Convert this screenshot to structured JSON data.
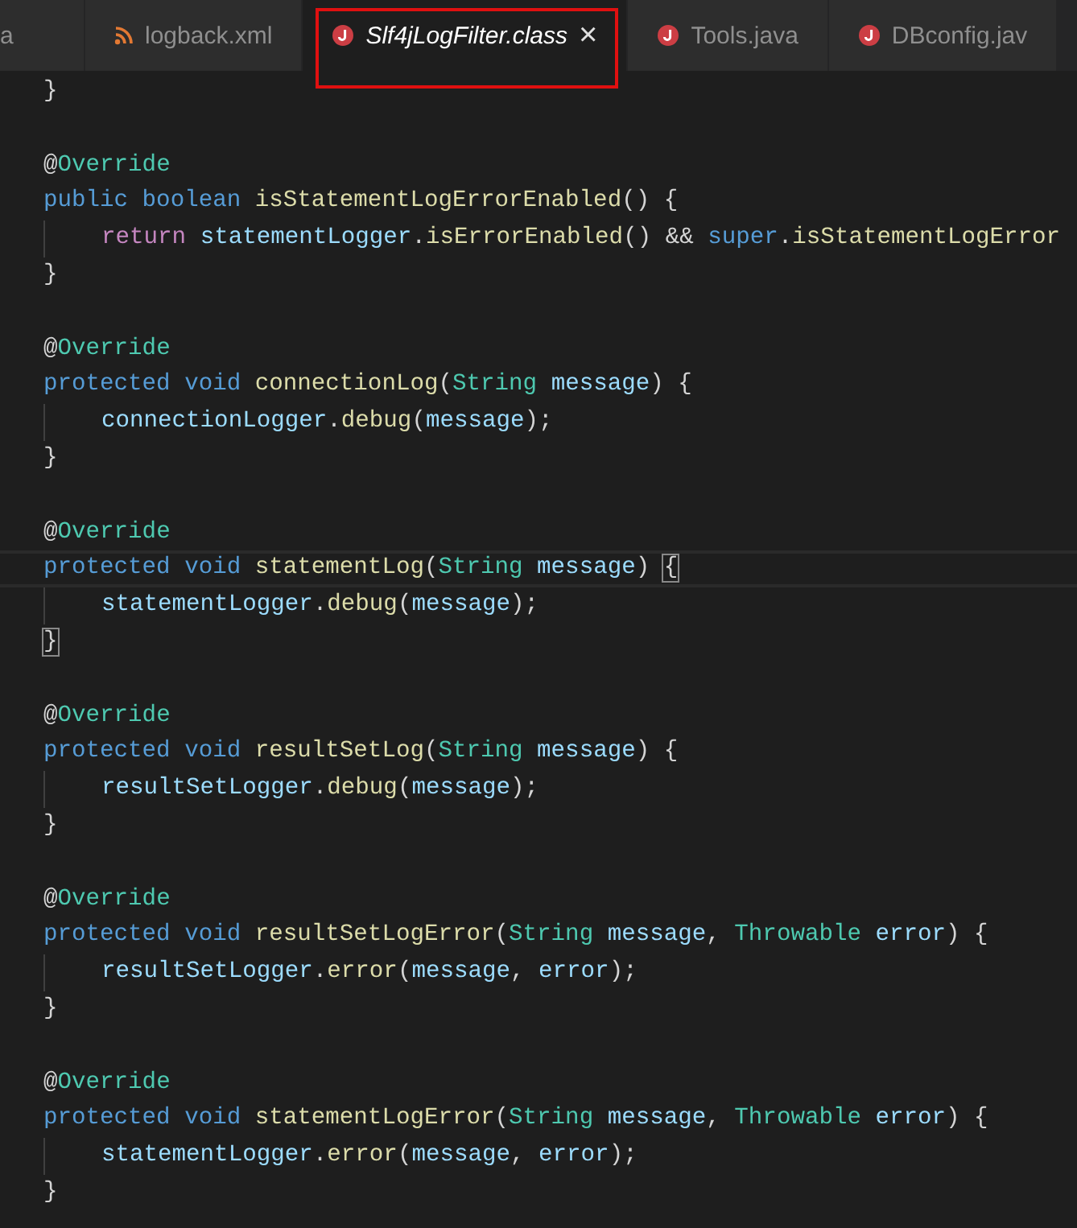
{
  "tabs": [
    {
      "label": "a",
      "kind": "plain",
      "selected": false,
      "preview": false,
      "closable": false,
      "highlighted": false
    },
    {
      "label": "logback.xml",
      "kind": "feed",
      "selected": false,
      "preview": false,
      "closable": false,
      "highlighted": false
    },
    {
      "label": "Slf4jLogFilter.class",
      "kind": "java",
      "selected": true,
      "preview": true,
      "closable": true,
      "highlighted": true
    },
    {
      "label": "Tools.java",
      "kind": "java",
      "selected": false,
      "preview": false,
      "closable": false,
      "highlighted": false
    },
    {
      "label": "DBconfig.jav",
      "kind": "java",
      "selected": false,
      "preview": false,
      "closable": false,
      "highlighted": false
    }
  ],
  "close_glyph": "×",
  "lines": [
    {
      "kind": "code",
      "indented": false,
      "current": false,
      "tokens": [
        {
          "kind": "plain",
          "text": "}"
        }
      ]
    },
    {
      "kind": "blank"
    },
    {
      "kind": "code",
      "indented": false,
      "current": false,
      "tokens": [
        {
          "kind": "plain",
          "text": "@"
        },
        {
          "kind": "type",
          "text": "Override"
        }
      ]
    },
    {
      "kind": "code",
      "indented": false,
      "current": false,
      "tokens": [
        {
          "kind": "keyword",
          "text": "public boolean "
        },
        {
          "kind": "method",
          "text": "isStatementLogErrorEnabled"
        },
        {
          "kind": "plain",
          "text": "() {"
        }
      ]
    },
    {
      "kind": "code",
      "indented": true,
      "current": false,
      "tokens": [
        {
          "kind": "control",
          "text": "return "
        },
        {
          "kind": "variable",
          "text": "statementLogger"
        },
        {
          "kind": "plain",
          "text": "."
        },
        {
          "kind": "method",
          "text": "isErrorEnabled"
        },
        {
          "kind": "plain",
          "text": "() && "
        },
        {
          "kind": "keyword",
          "text": "super"
        },
        {
          "kind": "plain",
          "text": "."
        },
        {
          "kind": "method",
          "text": "isStatementLogError"
        }
      ]
    },
    {
      "kind": "code",
      "indented": false,
      "current": false,
      "tokens": [
        {
          "kind": "plain",
          "text": "}"
        }
      ]
    },
    {
      "kind": "blank"
    },
    {
      "kind": "code",
      "indented": false,
      "current": false,
      "tokens": [
        {
          "kind": "plain",
          "text": "@"
        },
        {
          "kind": "type",
          "text": "Override"
        }
      ]
    },
    {
      "kind": "code",
      "indented": false,
      "current": false,
      "tokens": [
        {
          "kind": "keyword",
          "text": "protected void "
        },
        {
          "kind": "method",
          "text": "connectionLog"
        },
        {
          "kind": "plain",
          "text": "("
        },
        {
          "kind": "type",
          "text": "String "
        },
        {
          "kind": "variable",
          "text": "message"
        },
        {
          "kind": "plain",
          "text": ") {"
        }
      ]
    },
    {
      "kind": "code",
      "indented": true,
      "current": false,
      "tokens": [
        {
          "kind": "variable",
          "text": "connectionLogger"
        },
        {
          "kind": "plain",
          "text": "."
        },
        {
          "kind": "method",
          "text": "debug"
        },
        {
          "kind": "plain",
          "text": "("
        },
        {
          "kind": "variable",
          "text": "message"
        },
        {
          "kind": "plain",
          "text": ");"
        }
      ]
    },
    {
      "kind": "code",
      "indented": false,
      "current": false,
      "tokens": [
        {
          "kind": "plain",
          "text": "}"
        }
      ]
    },
    {
      "kind": "blank"
    },
    {
      "kind": "code",
      "indented": false,
      "current": false,
      "tokens": [
        {
          "kind": "plain",
          "text": "@"
        },
        {
          "kind": "type",
          "text": "Override"
        }
      ]
    },
    {
      "kind": "code",
      "indented": false,
      "current": true,
      "tokens": [
        {
          "kind": "keyword",
          "text": "protected void "
        },
        {
          "kind": "method",
          "text": "statementLog"
        },
        {
          "kind": "plain",
          "text": "("
        },
        {
          "kind": "type",
          "text": "String "
        },
        {
          "kind": "variable",
          "text": "message"
        },
        {
          "kind": "plain",
          "text": ") "
        },
        {
          "kind": "bracket",
          "text": "{",
          "matched": true
        }
      ]
    },
    {
      "kind": "code",
      "indented": true,
      "current": false,
      "tokens": [
        {
          "kind": "variable",
          "text": "statementLogger"
        },
        {
          "kind": "plain",
          "text": "."
        },
        {
          "kind": "method",
          "text": "debug"
        },
        {
          "kind": "plain",
          "text": "("
        },
        {
          "kind": "variable",
          "text": "message"
        },
        {
          "kind": "plain",
          "text": ");"
        }
      ]
    },
    {
      "kind": "code",
      "indented": false,
      "current": false,
      "tokens": [
        {
          "kind": "bracket",
          "text": "}",
          "matched": true
        }
      ]
    },
    {
      "kind": "blank"
    },
    {
      "kind": "code",
      "indented": false,
      "current": false,
      "tokens": [
        {
          "kind": "plain",
          "text": "@"
        },
        {
          "kind": "type",
          "text": "Override"
        }
      ]
    },
    {
      "kind": "code",
      "indented": false,
      "current": false,
      "tokens": [
        {
          "kind": "keyword",
          "text": "protected void "
        },
        {
          "kind": "method",
          "text": "resultSetLog"
        },
        {
          "kind": "plain",
          "text": "("
        },
        {
          "kind": "type",
          "text": "String "
        },
        {
          "kind": "variable",
          "text": "message"
        },
        {
          "kind": "plain",
          "text": ") {"
        }
      ]
    },
    {
      "kind": "code",
      "indented": true,
      "current": false,
      "tokens": [
        {
          "kind": "variable",
          "text": "resultSetLogger"
        },
        {
          "kind": "plain",
          "text": "."
        },
        {
          "kind": "method",
          "text": "debug"
        },
        {
          "kind": "plain",
          "text": "("
        },
        {
          "kind": "variable",
          "text": "message"
        },
        {
          "kind": "plain",
          "text": ");"
        }
      ]
    },
    {
      "kind": "code",
      "indented": false,
      "current": false,
      "tokens": [
        {
          "kind": "plain",
          "text": "}"
        }
      ]
    },
    {
      "kind": "blank"
    },
    {
      "kind": "code",
      "indented": false,
      "current": false,
      "tokens": [
        {
          "kind": "plain",
          "text": "@"
        },
        {
          "kind": "type",
          "text": "Override"
        }
      ]
    },
    {
      "kind": "code",
      "indented": false,
      "current": false,
      "tokens": [
        {
          "kind": "keyword",
          "text": "protected void "
        },
        {
          "kind": "method",
          "text": "resultSetLogError"
        },
        {
          "kind": "plain",
          "text": "("
        },
        {
          "kind": "type",
          "text": "String "
        },
        {
          "kind": "variable",
          "text": "message"
        },
        {
          "kind": "plain",
          "text": ", "
        },
        {
          "kind": "type",
          "text": "Throwable "
        },
        {
          "kind": "variable",
          "text": "error"
        },
        {
          "kind": "plain",
          "text": ") {"
        }
      ]
    },
    {
      "kind": "code",
      "indented": true,
      "current": false,
      "tokens": [
        {
          "kind": "variable",
          "text": "resultSetLogger"
        },
        {
          "kind": "plain",
          "text": "."
        },
        {
          "kind": "method",
          "text": "error"
        },
        {
          "kind": "plain",
          "text": "("
        },
        {
          "kind": "variable",
          "text": "message"
        },
        {
          "kind": "plain",
          "text": ", "
        },
        {
          "kind": "variable",
          "text": "error"
        },
        {
          "kind": "plain",
          "text": ");"
        }
      ]
    },
    {
      "kind": "code",
      "indented": false,
      "current": false,
      "tokens": [
        {
          "kind": "plain",
          "text": "}"
        }
      ]
    },
    {
      "kind": "blank"
    },
    {
      "kind": "code",
      "indented": false,
      "current": false,
      "tokens": [
        {
          "kind": "plain",
          "text": "@"
        },
        {
          "kind": "type",
          "text": "Override"
        }
      ]
    },
    {
      "kind": "code",
      "indented": false,
      "current": false,
      "tokens": [
        {
          "kind": "keyword",
          "text": "protected void "
        },
        {
          "kind": "method",
          "text": "statementLogError"
        },
        {
          "kind": "plain",
          "text": "("
        },
        {
          "kind": "type",
          "text": "String "
        },
        {
          "kind": "variable",
          "text": "message"
        },
        {
          "kind": "plain",
          "text": ", "
        },
        {
          "kind": "type",
          "text": "Throwable "
        },
        {
          "kind": "variable",
          "text": "error"
        },
        {
          "kind": "plain",
          "text": ") {"
        }
      ]
    },
    {
      "kind": "code",
      "indented": true,
      "current": false,
      "tokens": [
        {
          "kind": "variable",
          "text": "statementLogger"
        },
        {
          "kind": "plain",
          "text": "."
        },
        {
          "kind": "method",
          "text": "error"
        },
        {
          "kind": "plain",
          "text": "("
        },
        {
          "kind": "variable",
          "text": "message"
        },
        {
          "kind": "plain",
          "text": ", "
        },
        {
          "kind": "variable",
          "text": "error"
        },
        {
          "kind": "plain",
          "text": ");"
        }
      ]
    },
    {
      "kind": "code",
      "indented": false,
      "current": false,
      "tokens": [
        {
          "kind": "plain",
          "text": "}"
        }
      ]
    }
  ]
}
